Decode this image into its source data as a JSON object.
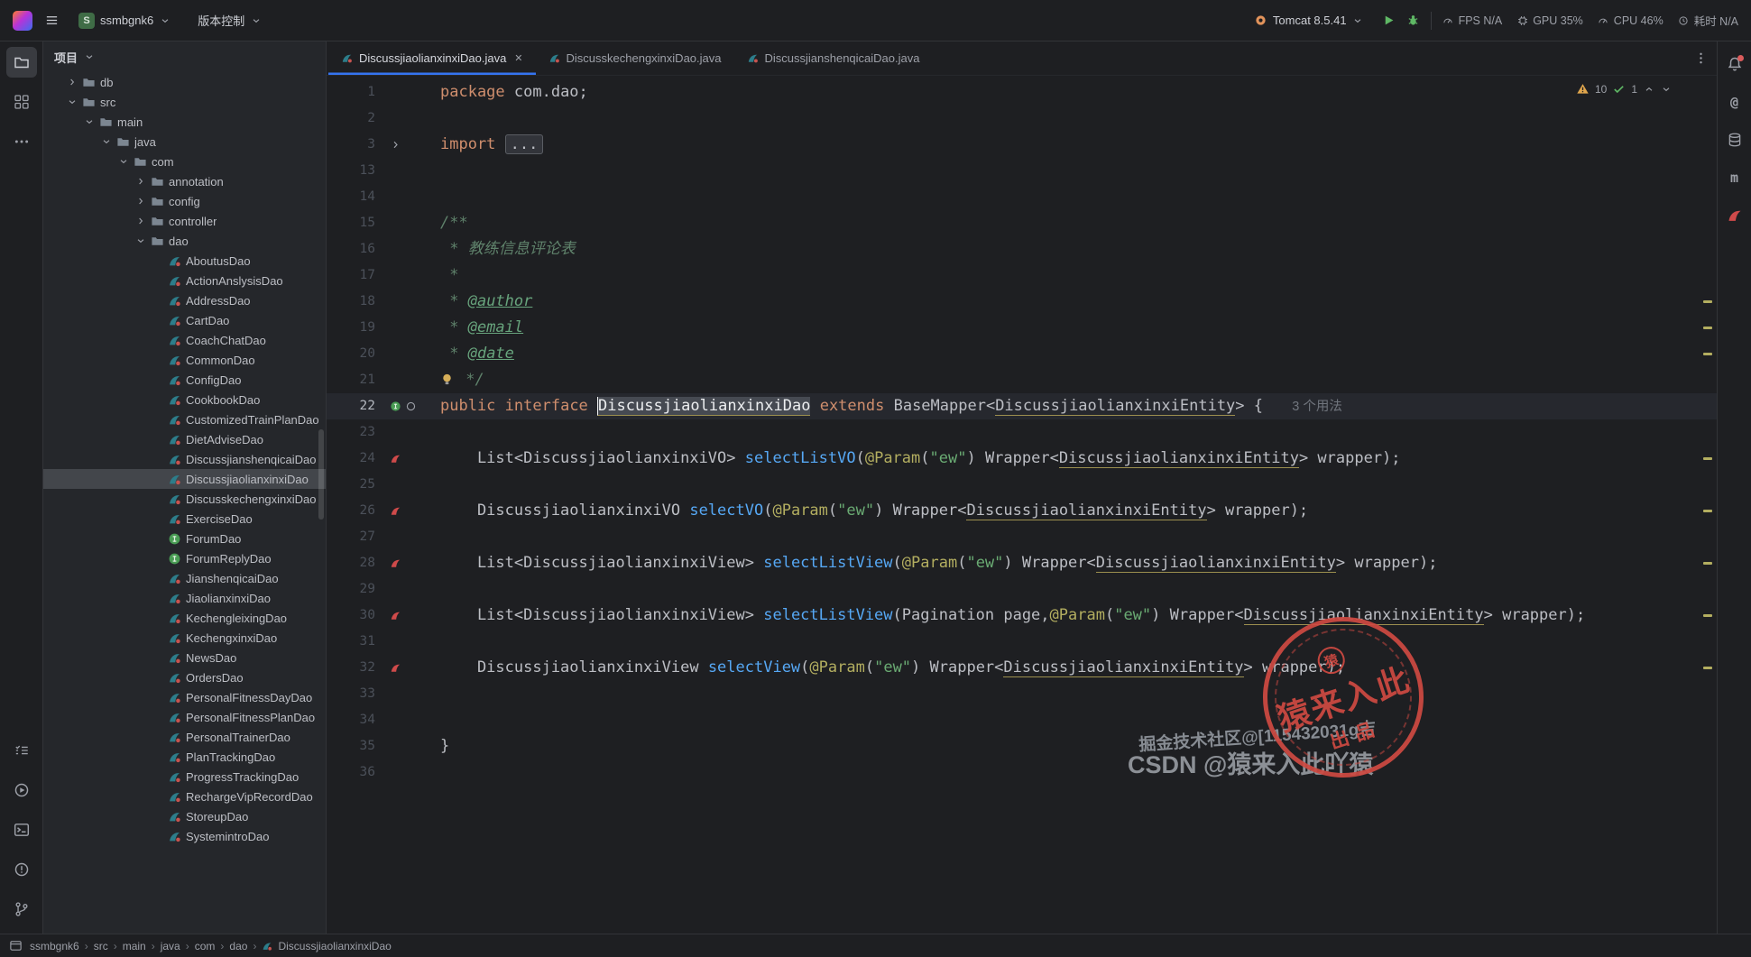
{
  "titlebar": {
    "project_initial": "S",
    "project_name": "ssmbgnk6",
    "vcs_label": "版本控制",
    "run_config": "Tomcat 8.5.41",
    "perf": [
      {
        "id": "fps",
        "icon": "gauge",
        "label": "FPS N/A"
      },
      {
        "id": "gpu",
        "icon": "chip",
        "label": "GPU 35%"
      },
      {
        "id": "cpu",
        "icon": "gauge",
        "label": "CPU 46%"
      },
      {
        "id": "time",
        "icon": "clock",
        "label": "耗时 N/A"
      }
    ]
  },
  "left_strip": {
    "top": [
      "project",
      "structure",
      "more"
    ],
    "bottom": [
      "todo",
      "run",
      "terminal",
      "problems",
      "git-branch"
    ]
  },
  "right_strip": [
    "notifications",
    "at",
    "database",
    "maven",
    "mybatis"
  ],
  "project_panel": {
    "title": "项目",
    "items": [
      {
        "label": "db",
        "depth": 1,
        "kind": "folder",
        "chevron": "right"
      },
      {
        "label": "src",
        "depth": 1,
        "kind": "folder",
        "chevron": "down"
      },
      {
        "label": "main",
        "depth": 2,
        "kind": "folder",
        "chevron": "down"
      },
      {
        "label": "java",
        "depth": 3,
        "kind": "folder",
        "chevron": "down"
      },
      {
        "label": "com",
        "depth": 4,
        "kind": "folder",
        "chevron": "down"
      },
      {
        "label": "annotation",
        "depth": 5,
        "kind": "folder",
        "chevron": "right"
      },
      {
        "label": "config",
        "depth": 5,
        "kind": "folder",
        "chevron": "right"
      },
      {
        "label": "controller",
        "depth": 5,
        "kind": "folder",
        "chevron": "right"
      },
      {
        "label": "dao",
        "depth": 5,
        "kind": "folder",
        "chevron": "down"
      },
      {
        "label": "AboutusDao",
        "depth": 6,
        "kind": "mapper"
      },
      {
        "label": "ActionAnslysisDao",
        "depth": 6,
        "kind": "mapper"
      },
      {
        "label": "AddressDao",
        "depth": 6,
        "kind": "mapper"
      },
      {
        "label": "CartDao",
        "depth": 6,
        "kind": "mapper"
      },
      {
        "label": "CoachChatDao",
        "depth": 6,
        "kind": "mapper"
      },
      {
        "label": "CommonDao",
        "depth": 6,
        "kind": "mapper"
      },
      {
        "label": "ConfigDao",
        "depth": 6,
        "kind": "mapper"
      },
      {
        "label": "CookbookDao",
        "depth": 6,
        "kind": "mapper"
      },
      {
        "label": "CustomizedTrainPlanDao",
        "depth": 6,
        "kind": "mapper"
      },
      {
        "label": "DietAdviseDao",
        "depth": 6,
        "kind": "mapper"
      },
      {
        "label": "DiscussjianshenqicaiDao",
        "depth": 6,
        "kind": "mapper"
      },
      {
        "label": "DiscussjiaolianxinxiDao",
        "depth": 6,
        "kind": "mapper",
        "selected": true
      },
      {
        "label": "DiscusskechengxinxiDao",
        "depth": 6,
        "kind": "mapper"
      },
      {
        "label": "ExerciseDao",
        "depth": 6,
        "kind": "mapper"
      },
      {
        "label": "ForumDao",
        "depth": 6,
        "kind": "interface"
      },
      {
        "label": "ForumReplyDao",
        "depth": 6,
        "kind": "interface"
      },
      {
        "label": "JianshenqicaiDao",
        "depth": 6,
        "kind": "mapper"
      },
      {
        "label": "JiaolianxinxiDao",
        "depth": 6,
        "kind": "mapper"
      },
      {
        "label": "KechengleixingDao",
        "depth": 6,
        "kind": "mapper"
      },
      {
        "label": "KechengxinxiDao",
        "depth": 6,
        "kind": "mapper"
      },
      {
        "label": "NewsDao",
        "depth": 6,
        "kind": "mapper"
      },
      {
        "label": "OrdersDao",
        "depth": 6,
        "kind": "mapper"
      },
      {
        "label": "PersonalFitnessDayDao",
        "depth": 6,
        "kind": "mapper"
      },
      {
        "label": "PersonalFitnessPlanDao",
        "depth": 6,
        "kind": "mapper"
      },
      {
        "label": "PersonalTrainerDao",
        "depth": 6,
        "kind": "mapper"
      },
      {
        "label": "PlanTrackingDao",
        "depth": 6,
        "kind": "mapper"
      },
      {
        "label": "ProgressTrackingDao",
        "depth": 6,
        "kind": "mapper"
      },
      {
        "label": "RechargeVipRecordDao",
        "depth": 6,
        "kind": "mapper"
      },
      {
        "label": "StoreupDao",
        "depth": 6,
        "kind": "mapper"
      },
      {
        "label": "SystemintroDao",
        "depth": 6,
        "kind": "mapper"
      }
    ]
  },
  "tabs": [
    {
      "label": "DiscussjiaolianxinxiDao.java",
      "active": true
    },
    {
      "label": "DiscusskechengxinxiDao.java",
      "active": false
    },
    {
      "label": "DiscussjianshenqicaiDao.java",
      "active": false
    }
  ],
  "inspections": {
    "warnings": "10",
    "passed": "1"
  },
  "editor": {
    "lines": [
      {
        "num": 1,
        "segs": [
          {
            "c": "kw",
            "t": "package"
          },
          {
            "c": "pl",
            "t": " com.dao;"
          }
        ]
      },
      {
        "num": 2,
        "segs": []
      },
      {
        "num": 3,
        "gutter": "fold",
        "segs": [
          {
            "c": "kw",
            "t": "import"
          },
          {
            "c": "pl",
            "t": " "
          },
          {
            "c": "fold",
            "t": "..."
          }
        ]
      },
      {
        "num": 13,
        "segs": []
      },
      {
        "num": 14,
        "segs": []
      },
      {
        "num": 15,
        "segs": [
          {
            "c": "cm",
            "t": "/**"
          }
        ]
      },
      {
        "num": 16,
        "segs": [
          {
            "c": "cm",
            "t": " * 教练信息评论表"
          }
        ]
      },
      {
        "num": 17,
        "segs": [
          {
            "c": "cm",
            "t": " *"
          }
        ]
      },
      {
        "num": 18,
        "segs": [
          {
            "c": "cm",
            "t": " * "
          },
          {
            "c": "tag",
            "t": "@author"
          }
        ]
      },
      {
        "num": 19,
        "segs": [
          {
            "c": "cm",
            "t": " * "
          },
          {
            "c": "tag",
            "t": "@email"
          }
        ]
      },
      {
        "num": 20,
        "segs": [
          {
            "c": "cm",
            "t": " * "
          },
          {
            "c": "tag",
            "t": "@date"
          }
        ]
      },
      {
        "num": 21,
        "bulb": true,
        "segs": [
          {
            "c": "cm",
            "t": " */"
          }
        ]
      },
      {
        "num": 22,
        "current": true,
        "gutter": "interface",
        "segs": [
          {
            "c": "kw",
            "t": "public"
          },
          {
            "c": "pl",
            "t": " "
          },
          {
            "c": "kw",
            "t": "interface"
          },
          {
            "c": "pl",
            "t": " "
          },
          {
            "c": "sel",
            "t": "DiscussjiaolianxinxiDao"
          },
          {
            "c": "pl",
            "t": " "
          },
          {
            "c": "kw",
            "t": "extends"
          },
          {
            "c": "pl",
            "t": " BaseMapper<"
          },
          {
            "c": "uref",
            "t": "DiscussjiaolianxinxiEntity"
          },
          {
            "c": "pl",
            "t": "> { "
          },
          {
            "c": "hint",
            "t": "3 个用法"
          }
        ]
      },
      {
        "num": 23,
        "segs": []
      },
      {
        "num": 24,
        "gutter": "mapper",
        "segs": [
          {
            "c": "pl",
            "t": "    List<DiscussjiaolianxinxiVO> "
          },
          {
            "c": "mth",
            "t": "selectListVO"
          },
          {
            "c": "pl",
            "t": "("
          },
          {
            "c": "ann",
            "t": "@Param"
          },
          {
            "c": "pl",
            "t": "("
          },
          {
            "c": "str",
            "t": "\"ew\""
          },
          {
            "c": "pl",
            "t": ") Wrapper<"
          },
          {
            "c": "uref",
            "t": "DiscussjiaolianxinxiEntity"
          },
          {
            "c": "pl",
            "t": "> wrapper);"
          }
        ]
      },
      {
        "num": 25,
        "segs": []
      },
      {
        "num": 26,
        "gutter": "mapper",
        "segs": [
          {
            "c": "pl",
            "t": "    DiscussjiaolianxinxiVO "
          },
          {
            "c": "mth",
            "t": "selectVO"
          },
          {
            "c": "pl",
            "t": "("
          },
          {
            "c": "ann",
            "t": "@Param"
          },
          {
            "c": "pl",
            "t": "("
          },
          {
            "c": "str",
            "t": "\"ew\""
          },
          {
            "c": "pl",
            "t": ") Wrapper<"
          },
          {
            "c": "uref",
            "t": "DiscussjiaolianxinxiEntity"
          },
          {
            "c": "pl",
            "t": "> wrapper);"
          }
        ]
      },
      {
        "num": 27,
        "segs": []
      },
      {
        "num": 28,
        "gutter": "mapper",
        "segs": [
          {
            "c": "pl",
            "t": "    List<DiscussjiaolianxinxiView> "
          },
          {
            "c": "mth",
            "t": "selectListView"
          },
          {
            "c": "pl",
            "t": "("
          },
          {
            "c": "ann",
            "t": "@Param"
          },
          {
            "c": "pl",
            "t": "("
          },
          {
            "c": "str",
            "t": "\"ew\""
          },
          {
            "c": "pl",
            "t": ") Wrapper<"
          },
          {
            "c": "uref",
            "t": "DiscussjiaolianxinxiEntity"
          },
          {
            "c": "pl",
            "t": "> wrapper);"
          }
        ]
      },
      {
        "num": 29,
        "segs": []
      },
      {
        "num": 30,
        "gutter": "mapper",
        "segs": [
          {
            "c": "pl",
            "t": "    List<DiscussjiaolianxinxiView> "
          },
          {
            "c": "mth",
            "t": "selectListView"
          },
          {
            "c": "pl",
            "t": "(Pagination page,"
          },
          {
            "c": "ann",
            "t": "@Param"
          },
          {
            "c": "pl",
            "t": "("
          },
          {
            "c": "str",
            "t": "\"ew\""
          },
          {
            "c": "pl",
            "t": ") Wrapper<"
          },
          {
            "c": "uref",
            "t": "DiscussjiaolianxinxiEntity"
          },
          {
            "c": "pl",
            "t": "> wrapper);"
          }
        ]
      },
      {
        "num": 31,
        "segs": []
      },
      {
        "num": 32,
        "gutter": "mapper",
        "segs": [
          {
            "c": "pl",
            "t": "    DiscussjiaolianxinxiView "
          },
          {
            "c": "mth",
            "t": "selectView"
          },
          {
            "c": "pl",
            "t": "("
          },
          {
            "c": "ann",
            "t": "@Param"
          },
          {
            "c": "pl",
            "t": "("
          },
          {
            "c": "str",
            "t": "\"ew\""
          },
          {
            "c": "pl",
            "t": ") Wrapper<"
          },
          {
            "c": "uref",
            "t": "DiscussjiaolianxinxiEntity"
          },
          {
            "c": "pl",
            "t": "> wrapper);"
          }
        ]
      },
      {
        "num": 33,
        "segs": []
      },
      {
        "num": 34,
        "segs": []
      },
      {
        "num": 35,
        "segs": [
          {
            "c": "pl",
            "t": "}"
          }
        ]
      },
      {
        "num": 36,
        "segs": []
      }
    ],
    "stripe_lines": [
      18,
      19,
      20,
      24,
      26,
      28,
      30,
      32
    ]
  },
  "statusbar": {
    "breadcrumbs": [
      "ssmbgnk6",
      "src",
      "main",
      "java",
      "com",
      "dao",
      "DiscussjiaolianxinxiDao"
    ]
  },
  "watermarks": {
    "juejin": "掘金技术社区@[115432031g吉",
    "csdn": "CSDN @猿来入此吖猿",
    "stamp_logo": "猿",
    "stamp_main": "猿来入此",
    "stamp_sub": "出品"
  }
}
